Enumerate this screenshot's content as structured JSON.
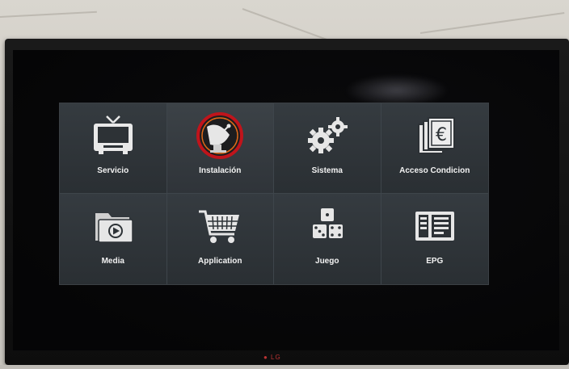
{
  "menu": {
    "items": [
      {
        "label": "Servicio",
        "icon": "tv-icon"
      },
      {
        "label": "Instalación",
        "icon": "satellite-dish-icon",
        "selected": true
      },
      {
        "label": "Sistema",
        "icon": "gears-icon"
      },
      {
        "label": "Acceso Condicion",
        "icon": "euro-card-icon"
      },
      {
        "label": "Media",
        "icon": "media-folder-icon"
      },
      {
        "label": "Application",
        "icon": "shopping-cart-icon"
      },
      {
        "label": "Juego",
        "icon": "dice-icon"
      },
      {
        "label": "EPG",
        "icon": "epg-guide-icon"
      }
    ]
  },
  "colors": {
    "menu_bg": "#2d3236",
    "selection_ring": "#c0141b",
    "label": "#f2f2f2"
  }
}
